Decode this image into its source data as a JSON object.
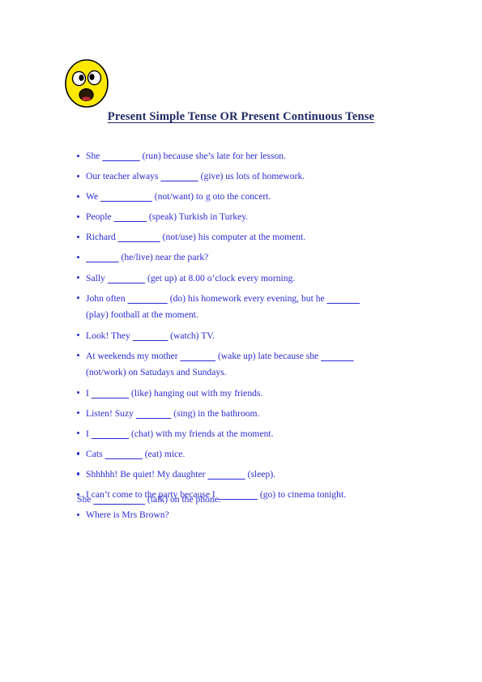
{
  "document": {
    "title": "Present Simple Tense OR Present Continuous Tense",
    "title_color": "#1f2a63",
    "body_color": "#2b2bd4",
    "background_color": "#ffffff"
  },
  "decoration": {
    "smiley_icon": "surprised-smiley-face-icon",
    "face_fill": "#ffe800",
    "face_outline": "#000000",
    "eye_fill": "#ffffff",
    "pupil_fill": "#000000",
    "mouth_fill": "#2b1a00",
    "tongue_fill": "#c03030"
  },
  "exercises": [
    {
      "lines": [
        [
          {
            "t": "text",
            "v": "She "
          },
          {
            "t": "blank",
            "v": "                "
          },
          {
            "t": "text",
            "v": " (run) because she’s late for her lesson."
          }
        ]
      ]
    },
    {
      "lines": [
        [
          {
            "t": "text",
            "v": "Our teacher always "
          },
          {
            "t": "blank",
            "v": "                "
          },
          {
            "t": "text",
            "v": " (give) us lots of homework."
          }
        ]
      ]
    },
    {
      "lines": [
        [
          {
            "t": "text",
            "v": "We "
          },
          {
            "t": "blank",
            "v": "                      "
          },
          {
            "t": "text",
            "v": " (not/want) to g oto the concert."
          }
        ]
      ]
    },
    {
      "lines": [
        [
          {
            "t": "text",
            "v": "People "
          },
          {
            "t": "blank",
            "v": "              "
          },
          {
            "t": "text",
            "v": " (speak) Turkish in Turkey."
          }
        ]
      ]
    },
    {
      "lines": [
        [
          {
            "t": "text",
            "v": "Richard "
          },
          {
            "t": "blank",
            "v": "                  "
          },
          {
            "t": "text",
            "v": " (not/use) his computer at the moment."
          }
        ]
      ]
    },
    {
      "lines": [
        [
          {
            "t": "blank",
            "v": "              "
          },
          {
            "t": "text",
            "v": " (he/live) near the park?"
          }
        ]
      ]
    },
    {
      "lines": [
        [
          {
            "t": "text",
            "v": "Sally "
          },
          {
            "t": "blank",
            "v": "                "
          },
          {
            "t": "text",
            "v": " (get up) at 8.00 o’clock every morning."
          }
        ]
      ]
    },
    {
      "two_line": true,
      "lines": [
        [
          {
            "t": "text",
            "v": "John often "
          },
          {
            "t": "blank",
            "v": "                 "
          },
          {
            "t": "text",
            "v": " (do) his homework every evening, but he "
          },
          {
            "t": "blank",
            "v": "              "
          }
        ],
        [
          {
            "t": "text",
            "v": "(play) football at the moment."
          }
        ]
      ]
    },
    {
      "lines": [
        [
          {
            "t": "text",
            "v": "Look! They  "
          },
          {
            "t": "blank",
            "v": "               "
          },
          {
            "t": "text",
            "v": " (watch) TV."
          }
        ]
      ]
    },
    {
      "two_line": true,
      "lines": [
        [
          {
            "t": "text",
            "v": "At weekends my mother "
          },
          {
            "t": "blank",
            "v": "               "
          },
          {
            "t": "text",
            "v": " (wake up) late because she "
          },
          {
            "t": "blank",
            "v": "              "
          }
        ],
        [
          {
            "t": "text",
            "v": "(not/work) on Satudays and Sundays."
          }
        ]
      ]
    },
    {
      "lines": [
        [
          {
            "t": "text",
            "v": "I "
          },
          {
            "t": "blank",
            "v": "                "
          },
          {
            "t": "text",
            "v": " (like) hanging out with my friends."
          }
        ]
      ]
    },
    {
      "lines": [
        [
          {
            "t": "text",
            "v": "Listen! Suzy  "
          },
          {
            "t": "blank",
            "v": "               "
          },
          {
            "t": "text",
            "v": " (sing) in the bathroom."
          }
        ]
      ]
    },
    {
      "lines": [
        [
          {
            "t": "text",
            "v": "I "
          },
          {
            "t": "blank",
            "v": "                "
          },
          {
            "t": "text",
            "v": " (chat) with my friends at the moment."
          }
        ]
      ]
    },
    {
      "lines": [
        [
          {
            "t": "text",
            "v": "Cats "
          },
          {
            "t": "blank",
            "v": "                "
          },
          {
            "t": "text",
            "v": " (eat) mice."
          }
        ]
      ]
    },
    {
      "lines": [
        [
          {
            "t": "text",
            "v": "Shhhhh! Be quiet! My daughter "
          },
          {
            "t": "blank",
            "v": "                "
          },
          {
            "t": "text",
            "v": " (sleep)."
          }
        ]
      ]
    },
    {
      "lines": [
        [
          {
            "t": "text",
            "v": "I can’t come to the party because I "
          },
          {
            "t": "blank",
            "v": "                 "
          },
          {
            "t": "text",
            "v": " (go) to cinema tonight."
          }
        ]
      ]
    },
    {
      "lines": [
        [
          {
            "t": "text",
            "v": "Where is Mrs Brown?"
          }
        ]
      ]
    }
  ],
  "trailing_line": [
    {
      "t": "text",
      "v": "She "
    },
    {
      "t": "blank",
      "v": "                      "
    },
    {
      "t": "text",
      "v": " (talk) on the phone."
    }
  ]
}
